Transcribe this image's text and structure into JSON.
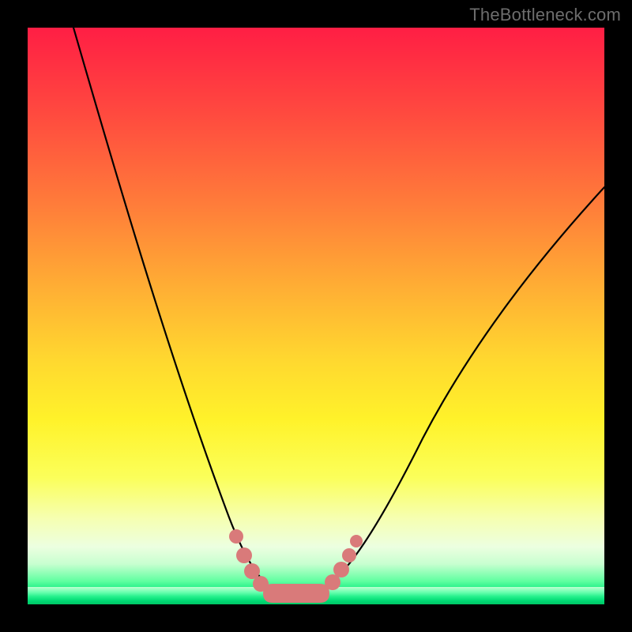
{
  "watermark": "TheBottleneck.com",
  "colors": {
    "frame": "#000000",
    "curve": "#000000",
    "marker": "#d97a7a",
    "gradient_top": "#ff1e44",
    "gradient_bottom": "#00c765"
  },
  "chart_data": {
    "type": "line",
    "title": "",
    "xlabel": "",
    "ylabel": "",
    "xlim": [
      0,
      100
    ],
    "ylim": [
      0,
      100
    ],
    "grid": false,
    "legend": false,
    "series": [
      {
        "name": "left-branch",
        "x": [
          8,
          12,
          16,
          20,
          24,
          27,
          30,
          32,
          34,
          36,
          37.5,
          39,
          40,
          41,
          42
        ],
        "y": [
          100,
          84,
          70,
          57,
          45,
          35,
          26,
          20,
          14,
          9,
          6,
          4,
          2.5,
          1.5,
          1
        ]
      },
      {
        "name": "trough",
        "x": [
          42,
          44,
          46,
          48,
          50
        ],
        "y": [
          1,
          0.7,
          0.6,
          0.7,
          1
        ]
      },
      {
        "name": "right-branch",
        "x": [
          50,
          52,
          55,
          58,
          62,
          66,
          71,
          76,
          82,
          88,
          94,
          100
        ],
        "y": [
          1,
          2,
          5,
          9,
          15,
          22,
          30,
          38,
          47,
          56,
          64,
          72
        ]
      }
    ],
    "markers": {
      "name": "highlight-dots",
      "x": [
        37,
        38.5,
        40,
        41.5,
        43,
        45,
        47,
        49,
        51,
        52.5,
        54,
        55.5
      ],
      "y": [
        8,
        5.5,
        3.5,
        2.2,
        1.4,
        1.0,
        0.9,
        1.0,
        1.3,
        2.2,
        4.0,
        6.5
      ]
    }
  }
}
